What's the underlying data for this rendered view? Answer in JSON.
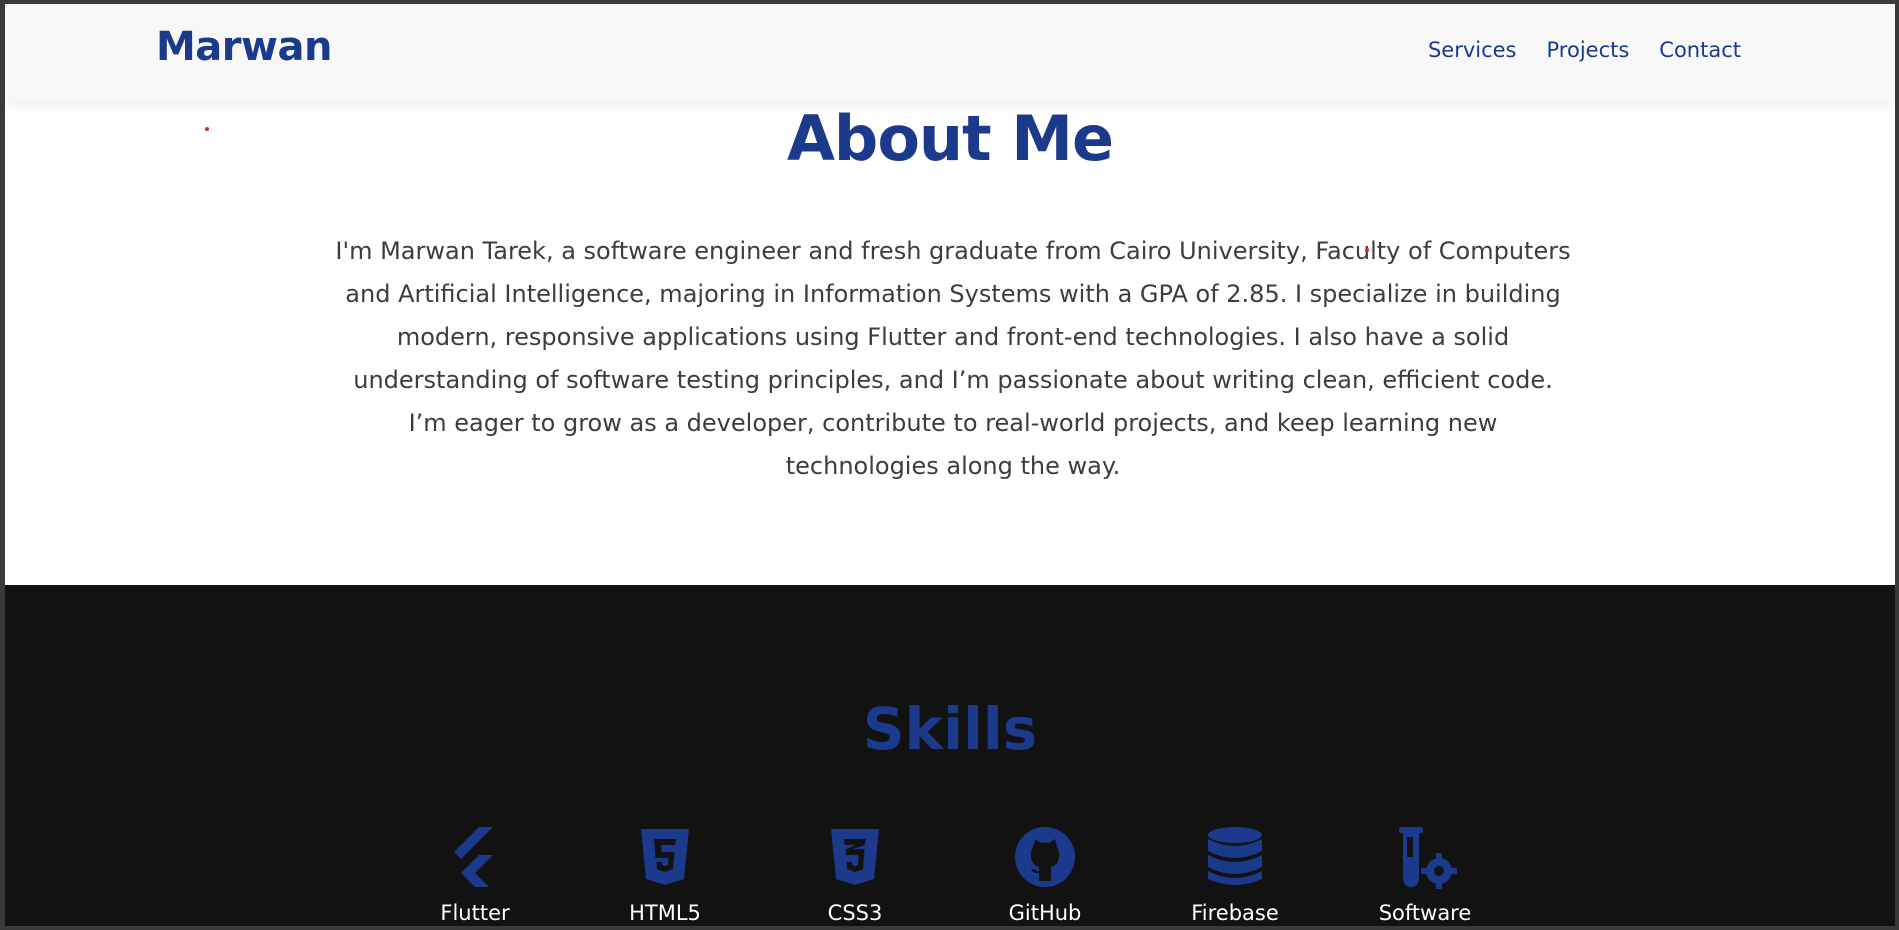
{
  "nav": {
    "logo": "Marwan",
    "links": [
      {
        "label": "Services"
      },
      {
        "label": "Projects"
      },
      {
        "label": "Contact"
      }
    ]
  },
  "about": {
    "title": "About Me",
    "text": "I'm Marwan Tarek, a software engineer and fresh graduate from Cairo University, Faculty of Computers and Artificial Intelligence, majoring in Information Systems with a GPA of 2.85. I specialize in building modern, responsive applications using Flutter and front-end technologies. I also have a solid understanding of software testing principles, and I’m passionate about writing clean, efficient code. I’m eager to grow as a developer, contribute to real-world projects, and keep learning new technologies along the way."
  },
  "skills": {
    "title": "Skills",
    "items": [
      {
        "label": "Flutter",
        "icon": "flutter-icon"
      },
      {
        "label": "HTML5",
        "icon": "html5-icon"
      },
      {
        "label": "CSS3",
        "icon": "css3-icon"
      },
      {
        "label": "GitHub",
        "icon": "github-icon"
      },
      {
        "label": "Firebase",
        "icon": "database-icon"
      },
      {
        "label": "Software",
        "icon": "flask-gear-icon"
      }
    ]
  },
  "colors": {
    "brand": "#1b3a8c",
    "skills_bg": "#121212",
    "text": "#3d3d3d"
  }
}
